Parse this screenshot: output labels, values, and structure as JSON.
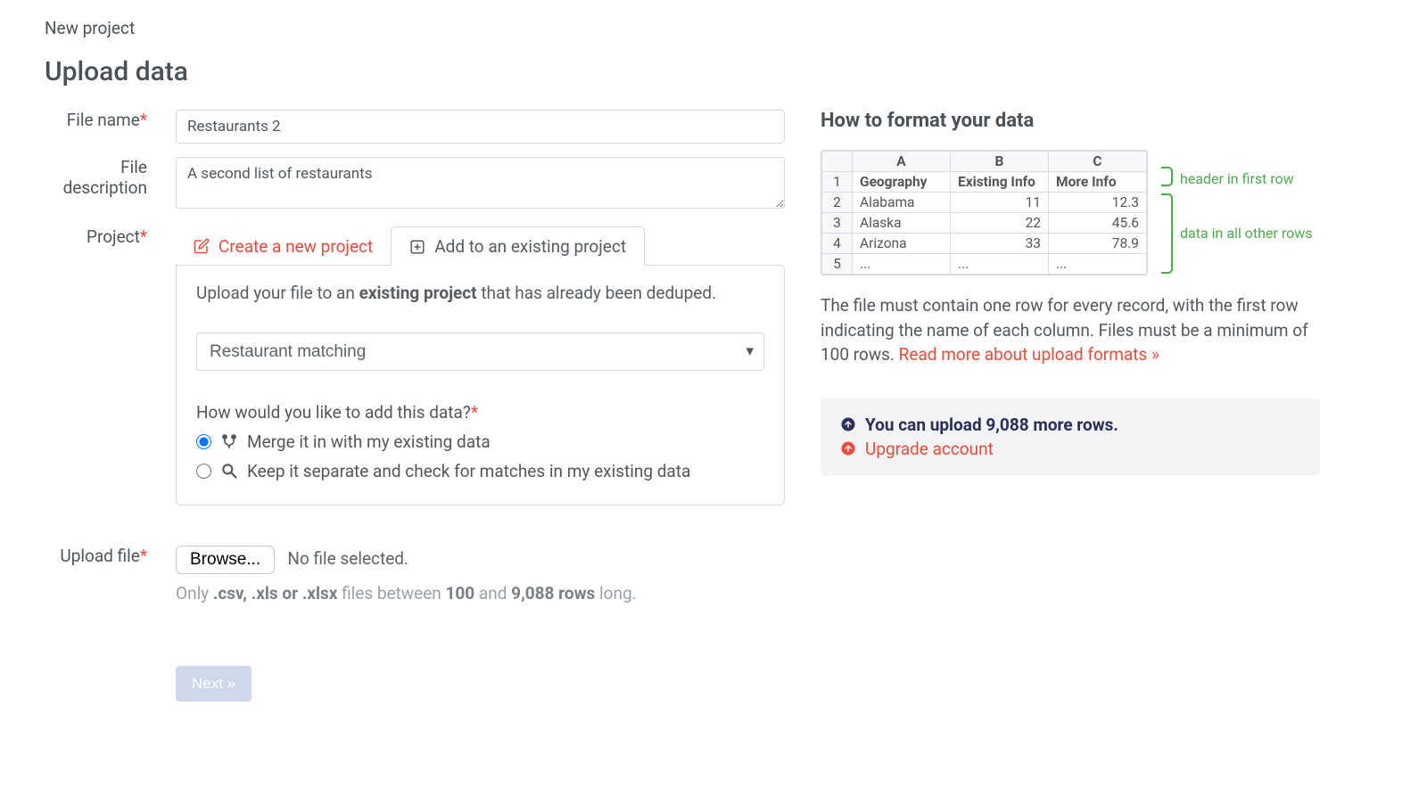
{
  "breadcrumb": "New project",
  "heading": "Upload data",
  "form": {
    "file_name_label": "File name",
    "file_name_value": "Restaurants 2",
    "file_desc_label": "File description",
    "file_desc_value": "A second list of restaurants",
    "project_label": "Project",
    "tab_create": "Create a new project",
    "tab_existing": "Add to an existing project",
    "panel_text_pre": "Upload your file to an ",
    "panel_text_bold": "existing project",
    "panel_text_post": " that has already been deduped.",
    "project_selected": "Restaurant matching",
    "add_mode_q": "How would you like to add this data?",
    "merge_label": "Merge it in with my existing data",
    "separate_label": "Keep it separate and check for matches in my existing data",
    "upload_file_label": "Upload file",
    "browse_label": "Browse...",
    "no_file_text": "No file selected.",
    "file_help_pre": "Only ",
    "file_help_ext": ".csv, .xls or .xlsx",
    "file_help_mid": " files between ",
    "file_help_min": "100",
    "file_help_and": " and ",
    "file_help_max": "9,088 rows",
    "file_help_end": " long.",
    "next_label": "Next »"
  },
  "aside": {
    "heading": "How to format your data",
    "table_cols": [
      "A",
      "B",
      "C"
    ],
    "table_head": [
      "Geography",
      "Existing Info",
      "More Info"
    ],
    "table_rows": [
      {
        "n": "2",
        "c": [
          "Alabama",
          "11",
          "12.3"
        ]
      },
      {
        "n": "3",
        "c": [
          "Alaska",
          "22",
          "45.6"
        ]
      },
      {
        "n": "4",
        "c": [
          "Arizona",
          "33",
          "78.9"
        ]
      },
      {
        "n": "5",
        "c": [
          "...",
          "...",
          "..."
        ]
      }
    ],
    "ann_header": "header in first row",
    "ann_data": "data in all other rows",
    "text": "The file must contain one row for every record, with the first row indicating the name of each column. Files must be a minimum of 100 rows. ",
    "read_more": "Read more about upload formats »",
    "notice_pre": "You can upload ",
    "notice_num": "9,088 more rows",
    "notice_dot": ".",
    "upgrade": "Upgrade account"
  }
}
